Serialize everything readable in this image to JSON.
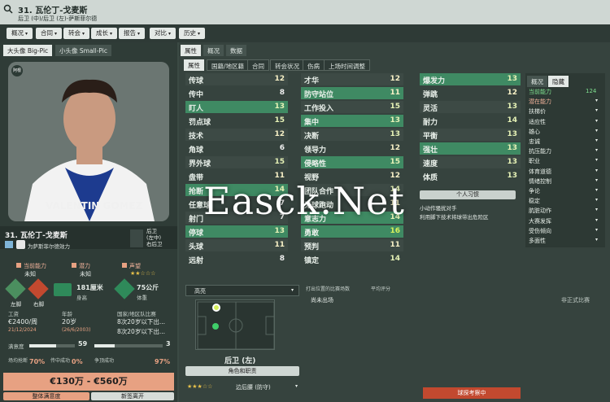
{
  "header": {
    "title": "31. 瓦伦丁-戈麦斯",
    "subtitle": "后卫 (中)/后卫 (左)-萨斯菲尔德"
  },
  "nav": [
    {
      "label": "概况"
    },
    {
      "label": "合同"
    },
    {
      "label": "转会"
    },
    {
      "label": "成长"
    },
    {
      "label": "报告"
    },
    {
      "label": "对比"
    },
    {
      "label": "历史"
    }
  ],
  "photo_tabs": {
    "big": "大头像 Big-Pic",
    "small": "小头像 Small-Pic"
  },
  "photo_text": {
    "name_on_shirt": "VALENTIN GOMEZ",
    "badge": "阿根"
  },
  "player": {
    "name": "31. 瓦伦丁-戈麦斯",
    "club_line": "为萨斯菲尔德效力",
    "position_line1": "后卫",
    "position_line2": "(左中)",
    "position_line3": "右后卫",
    "current_ability_label": "当前能力",
    "current_ability_value": "未知",
    "potential_label": "潜力",
    "potential_value": "未知",
    "reputation_label": "声望",
    "foot_left_label": "左脚",
    "foot_right_label": "右脚",
    "height": "181厘米",
    "height_label": "身高",
    "weight": "75公斤",
    "weight_label": "体重",
    "wage_label": "工资",
    "wage": "€2400/周",
    "wage_date": "21/12/2024",
    "age_label": "年龄",
    "age": "20岁",
    "dob": "(26/6/2003)",
    "intl_label": "国家/地区队比赛",
    "intl1": "8次20岁以下出...",
    "intl2": "8次20岁以下出...",
    "morale_label": "满意度",
    "morale_value": "59",
    "fit_value": "3",
    "pct1_label": "场均抢断",
    "pct1": "70%",
    "pct2_label": "传中成功",
    "pct2": "0%",
    "pct3_label": "争顶成功",
    "pct3": "97%",
    "value_range": "€130万 - €560万",
    "overview_btn": "整体满意度",
    "status_btn": "新签离开"
  },
  "tabs_top": [
    {
      "label": "属性"
    },
    {
      "label": "概况"
    },
    {
      "label": "数据"
    }
  ],
  "tabs_sub": [
    {
      "label": "属性"
    },
    {
      "label": "国籍/地区籍"
    },
    {
      "label": "合同"
    },
    {
      "label": "转会状况"
    },
    {
      "label": "伤病"
    },
    {
      "label": "上场时间调整"
    }
  ],
  "attributes": {
    "technical": [
      {
        "name": "传球",
        "value": "12"
      },
      {
        "name": "传中",
        "value": "8"
      },
      {
        "name": "盯人",
        "value": "13"
      },
      {
        "name": "罚点球",
        "value": "15"
      },
      {
        "name": "技术",
        "value": "12"
      },
      {
        "name": "角球",
        "value": "6"
      },
      {
        "name": "界外球",
        "value": "15"
      },
      {
        "name": "盘带",
        "value": "11"
      },
      {
        "name": "抢断",
        "value": "14"
      },
      {
        "name": "任意球",
        "value": "7"
      },
      {
        "name": "射门",
        "value": "7"
      },
      {
        "name": "停球",
        "value": "13"
      },
      {
        "name": "头球",
        "value": "11"
      },
      {
        "name": "远射",
        "value": "8"
      }
    ],
    "mental": [
      {
        "name": "才华",
        "value": "12"
      },
      {
        "name": "防守站位",
        "value": "11"
      },
      {
        "name": "工作投入",
        "value": "15"
      },
      {
        "name": "集中",
        "value": "13"
      },
      {
        "name": "决断",
        "value": "13"
      },
      {
        "name": "领导力",
        "value": "12"
      },
      {
        "name": "侵略性",
        "value": "15"
      },
      {
        "name": "视野",
        "value": "12"
      },
      {
        "name": "团队合作",
        "value": "14"
      },
      {
        "name": "无球跑动",
        "value": "11"
      },
      {
        "name": "意志力",
        "value": "14"
      },
      {
        "name": "勇敢",
        "value": "16"
      },
      {
        "name": "预判",
        "value": "11"
      },
      {
        "name": "镇定",
        "value": "14"
      }
    ],
    "physical": [
      {
        "name": "爆发力",
        "value": "13"
      },
      {
        "name": "弹跳",
        "value": "12"
      },
      {
        "name": "灵活",
        "value": "13"
      },
      {
        "name": "耐力",
        "value": "14"
      },
      {
        "name": "平衡",
        "value": "13"
      },
      {
        "name": "强壮",
        "value": "13"
      },
      {
        "name": "速度",
        "value": "13"
      },
      {
        "name": "体质",
        "value": "13"
      }
    ]
  },
  "traits": {
    "button": "个人习惯",
    "line1": "小动作骚扰对手",
    "line2": "利用脚下技术将球带出危险区"
  },
  "watermark": "Easck.Net",
  "right_panel": {
    "tab1": "概况",
    "tab2": "隐藏",
    "items": [
      {
        "label": "当前能力",
        "value": "124"
      },
      {
        "label": "潜在能力",
        "value": ""
      },
      {
        "label": "扶梯价",
        "value": ""
      },
      {
        "label": "适应性",
        "value": ""
      },
      {
        "label": "雄心",
        "value": ""
      },
      {
        "label": "忠诚",
        "value": ""
      },
      {
        "label": "抗压能力",
        "value": ""
      },
      {
        "label": "职业",
        "value": ""
      },
      {
        "label": "体育道德",
        "value": ""
      },
      {
        "label": "情绪控制",
        "value": ""
      },
      {
        "label": "争论",
        "value": ""
      },
      {
        "label": "稳定",
        "value": ""
      },
      {
        "label": "肮脏动作",
        "value": ""
      },
      {
        "label": "大赛发挥",
        "value": ""
      },
      {
        "label": "受伤倾向",
        "value": ""
      },
      {
        "label": "多面性",
        "value": ""
      }
    ]
  },
  "bottom": {
    "formation_label": "高亮",
    "position_label": "后卫 (左)",
    "role_button": "角色和职责",
    "role_select": "边后腰 (防守)",
    "stats_col1": "打出位置的比赛场数",
    "stats_col2": "平均评分",
    "stats_row": "尚未出场",
    "col3_label": "非正式比赛",
    "scout_btn": "球探考察中"
  },
  "colors": {
    "highlight": "#3f8a63",
    "accent_orange": "#e7a182"
  }
}
